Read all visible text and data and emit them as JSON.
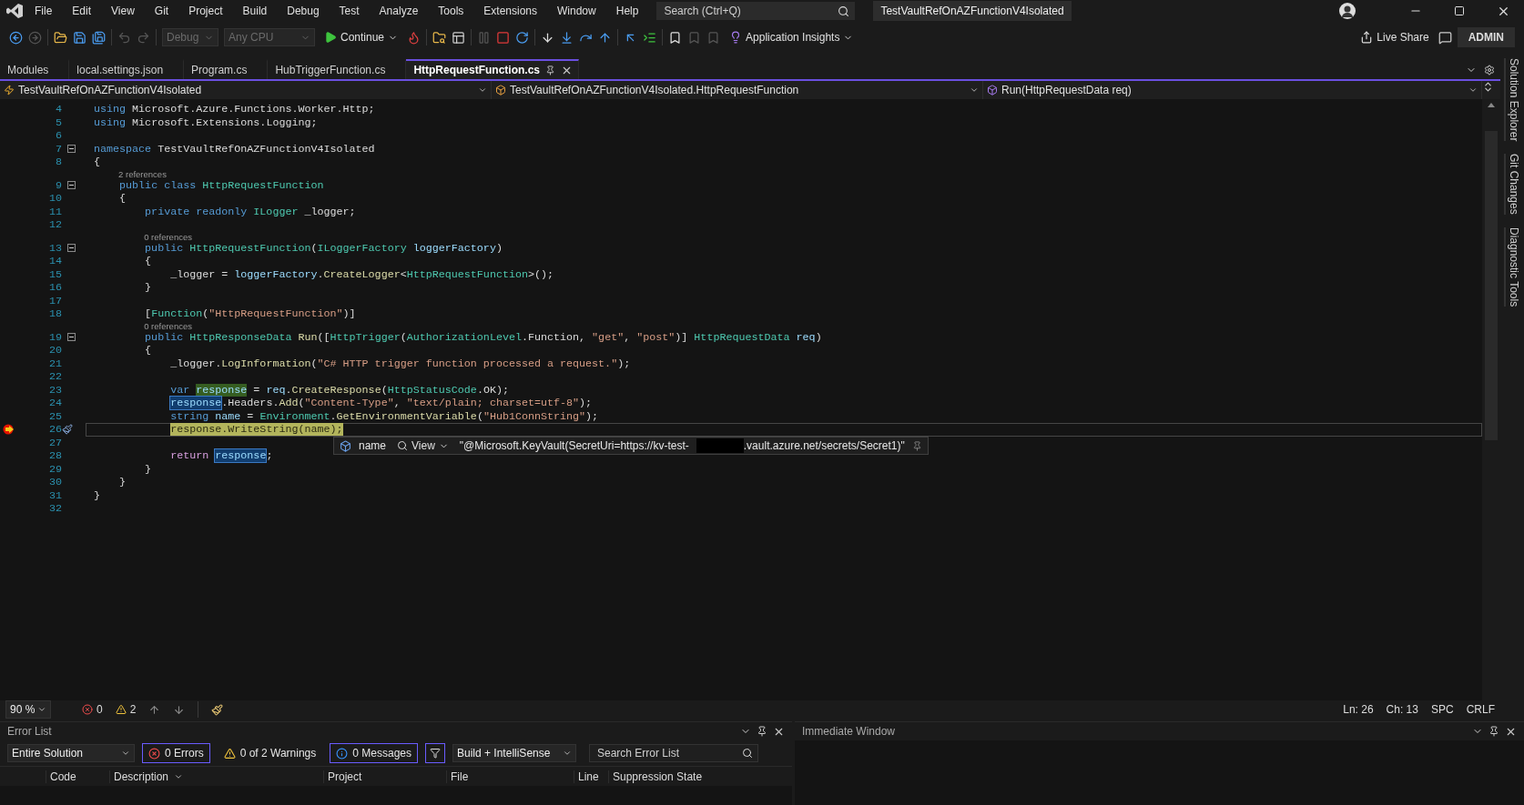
{
  "menu": {
    "items": [
      "File",
      "Edit",
      "View",
      "Git",
      "Project",
      "Build",
      "Debug",
      "Test",
      "Analyze",
      "Tools",
      "Extensions",
      "Window",
      "Help"
    ],
    "search_placeholder": "Search (Ctrl+Q)",
    "solution": "TestVaultRefOnAZFunctionV4Isolated"
  },
  "toolbar": {
    "configuration": "Debug",
    "platform": "Any CPU",
    "continue": "Continue",
    "insights": "Application Insights",
    "live_share": "Live Share",
    "account": "ADMIN"
  },
  "tabs": [
    {
      "label": "Modules",
      "selected": false
    },
    {
      "label": "local.settings.json",
      "selected": false
    },
    {
      "label": "Program.cs",
      "selected": false
    },
    {
      "label": "HubTriggerFunction.cs",
      "selected": false
    },
    {
      "label": "HttpRequestFunction.cs",
      "selected": true
    }
  ],
  "nav": {
    "project": "TestVaultRefOnAZFunctionV4Isolated",
    "type": "TestVaultRefOnAZFunctionV4Isolated.HttpRequestFunction",
    "member": "Run(HttpRequestData req)"
  },
  "code": {
    "lines": [
      {
        "number": "4",
        "foldable": false,
        "current": false,
        "tokens": [
          {
            "kind": "kw",
            "text": "using"
          },
          {
            "kind": "plain",
            "text": " Microsoft.Azure.Functions.Worker.Http;"
          }
        ]
      },
      {
        "number": "5",
        "foldable": false,
        "current": false,
        "tokens": [
          {
            "kind": "kw",
            "text": "using"
          },
          {
            "kind": "plain",
            "text": " Microsoft.Extensions.Logging;"
          }
        ]
      },
      {
        "number": "6",
        "foldable": false,
        "current": false
      },
      {
        "number": "7",
        "foldable": true,
        "current": false,
        "tokens": [
          {
            "kind": "kw",
            "text": "namespace"
          },
          {
            "kind": "plain",
            "text": " TestVaultRefOnAZFunctionV4Isolated"
          }
        ]
      },
      {
        "number": "8",
        "foldable": false,
        "current": false,
        "tokens": [
          {
            "kind": "plain",
            "text": "{"
          }
        ]
      },
      {
        "number": "9",
        "foldable": true,
        "current": false,
        "refs": "2 references",
        "tokens": [
          {
            "kind": "kw",
            "text": "    public class "
          },
          {
            "kind": "type",
            "text": "HttpRequestFunction"
          }
        ]
      },
      {
        "number": "10",
        "foldable": false,
        "current": false,
        "tokens": [
          {
            "kind": "plain",
            "text": "    {"
          }
        ]
      },
      {
        "number": "11",
        "foldable": false,
        "current": false,
        "tokens": [
          {
            "kind": "kw",
            "text": "        private readonly "
          },
          {
            "kind": "type",
            "text": "ILogger"
          },
          {
            "kind": "plain",
            "text": " _logger;"
          }
        ]
      },
      {
        "number": "12",
        "foldable": false,
        "current": false
      },
      {
        "number": "13",
        "foldable": true,
        "current": false,
        "refs": "0 references",
        "tokens": [
          {
            "kind": "kw",
            "text": "        public "
          },
          {
            "kind": "type",
            "text": "HttpRequestFunction"
          },
          {
            "kind": "plain",
            "text": "("
          },
          {
            "kind": "type",
            "text": "ILoggerFactory"
          },
          {
            "kind": "param",
            "text": " loggerFactory"
          },
          {
            "kind": "plain",
            "text": ")"
          }
        ]
      },
      {
        "number": "14",
        "foldable": false,
        "current": false,
        "tokens": [
          {
            "kind": "plain",
            "text": "        {"
          }
        ]
      },
      {
        "number": "15",
        "foldable": false,
        "current": false,
        "tokens": [
          {
            "kind": "plain",
            "text": "            _logger = "
          },
          {
            "kind": "param",
            "text": "loggerFactory"
          },
          {
            "kind": "plain",
            "text": "."
          },
          {
            "kind": "method",
            "text": "CreateLogger"
          },
          {
            "kind": "plain",
            "text": "<"
          },
          {
            "kind": "type",
            "text": "HttpRequestFunction"
          },
          {
            "kind": "plain",
            "text": ">();"
          }
        ]
      },
      {
        "number": "16",
        "foldable": false,
        "current": false,
        "tokens": [
          {
            "kind": "plain",
            "text": "        }"
          }
        ]
      },
      {
        "number": "17",
        "foldable": false,
        "current": false
      },
      {
        "number": "18",
        "foldable": false,
        "current": false,
        "tokens": [
          {
            "kind": "plain",
            "text": "        ["
          },
          {
            "kind": "type",
            "text": "Function"
          },
          {
            "kind": "plain",
            "text": "("
          },
          {
            "kind": "str",
            "text": "\"HttpRequestFunction\""
          },
          {
            "kind": "plain",
            "text": ")]"
          }
        ]
      },
      {
        "number": "19",
        "foldable": true,
        "current": false,
        "refs": "0 references",
        "tokens": [
          {
            "kind": "kw",
            "text": "        public "
          },
          {
            "kind": "type",
            "text": "HttpResponseData"
          },
          {
            "kind": "method",
            "text": " Run"
          },
          {
            "kind": "plain",
            "text": "(["
          },
          {
            "kind": "type",
            "text": "HttpTrigger"
          },
          {
            "kind": "plain",
            "text": "("
          },
          {
            "kind": "type",
            "text": "AuthorizationLevel"
          },
          {
            "kind": "plain",
            "text": ".Function, "
          },
          {
            "kind": "str",
            "text": "\"get\""
          },
          {
            "kind": "plain",
            "text": ", "
          },
          {
            "kind": "str",
            "text": "\"post\""
          },
          {
            "kind": "plain",
            "text": ")] "
          },
          {
            "kind": "type",
            "text": "HttpRequestData"
          },
          {
            "kind": "param",
            "text": " req"
          },
          {
            "kind": "plain",
            "text": ")"
          }
        ]
      },
      {
        "number": "20",
        "foldable": false,
        "current": false,
        "tokens": [
          {
            "kind": "plain",
            "text": "        {"
          }
        ]
      },
      {
        "number": "21",
        "foldable": false,
        "current": false,
        "tokens": [
          {
            "kind": "plain",
            "text": "            _logger."
          },
          {
            "kind": "method",
            "text": "LogInformation"
          },
          {
            "kind": "plain",
            "text": "("
          },
          {
            "kind": "str",
            "text": "\"C# HTTP trigger function processed a request.\""
          },
          {
            "kind": "plain",
            "text": ");"
          }
        ]
      },
      {
        "number": "22",
        "foldable": false,
        "current": false
      },
      {
        "number": "23",
        "foldable": false,
        "current": false,
        "tokens": [
          {
            "kind": "kw",
            "text": "            var "
          },
          {
            "kind": "write",
            "text": "response"
          },
          {
            "kind": "plain",
            "text": " = "
          },
          {
            "kind": "param",
            "text": "req"
          },
          {
            "kind": "plain",
            "text": "."
          },
          {
            "kind": "method",
            "text": "CreateResponse"
          },
          {
            "kind": "plain",
            "text": "("
          },
          {
            "kind": "type",
            "text": "HttpStatusCode"
          },
          {
            "kind": "plain",
            "text": ".OK);"
          }
        ]
      },
      {
        "number": "24",
        "foldable": false,
        "current": false,
        "tokens": [
          {
            "kind": "read",
            "text": "            response"
          },
          {
            "kind": "plain",
            "text": ".Headers."
          },
          {
            "kind": "method",
            "text": "Add"
          },
          {
            "kind": "plain",
            "text": "("
          },
          {
            "kind": "str",
            "text": "\"Content-Type\""
          },
          {
            "kind": "plain",
            "text": ", "
          },
          {
            "kind": "str",
            "text": "\"text/plain; charset=utf-8\""
          },
          {
            "kind": "plain",
            "text": ");"
          }
        ]
      },
      {
        "number": "25",
        "foldable": false,
        "current": false,
        "tokens": [
          {
            "kind": "kw",
            "text": "            string "
          },
          {
            "kind": "param",
            "text": "name"
          },
          {
            "kind": "plain",
            "text": " = "
          },
          {
            "kind": "type",
            "text": "Environment"
          },
          {
            "kind": "plain",
            "text": "."
          },
          {
            "kind": "method",
            "text": "GetEnvironmentVariable"
          },
          {
            "kind": "plain",
            "text": "("
          },
          {
            "kind": "str",
            "text": "\"Hub1ConnString\""
          },
          {
            "kind": "plain",
            "text": ");"
          }
        ]
      },
      {
        "number": "26",
        "foldable": false,
        "current": true,
        "tokens": [
          {
            "kind": "statement",
            "text": "            response.WriteString(name);"
          }
        ]
      },
      {
        "number": "27",
        "foldable": false,
        "current": false
      },
      {
        "number": "28",
        "foldable": false,
        "current": false,
        "tokens": [
          {
            "kind": "ctrl",
            "text": "            return "
          },
          {
            "kind": "read",
            "text": "response"
          },
          {
            "kind": "plain",
            "text": ";"
          }
        ]
      },
      {
        "number": "29",
        "foldable": false,
        "current": false,
        "tokens": [
          {
            "kind": "plain",
            "text": "        }"
          }
        ]
      },
      {
        "number": "30",
        "foldable": false,
        "current": false,
        "tokens": [
          {
            "kind": "plain",
            "text": "    }"
          }
        ]
      },
      {
        "number": "31",
        "foldable": false,
        "current": false,
        "tokens": [
          {
            "kind": "plain",
            "text": "}"
          }
        ]
      },
      {
        "number": "32",
        "foldable": false,
        "current": false
      }
    ],
    "datatip": {
      "name": "name",
      "view": "View",
      "value_start": "\"@Microsoft.KeyVault(SecretUri=https://kv-test-",
      "value_end": ".vault.azure.net/secrets/Secret1)\""
    }
  },
  "editor_status": {
    "zoom": "90 %",
    "errors": "0",
    "warnings": "2",
    "line": "Ln: 26",
    "column": "Ch: 13",
    "spacing": "SPC",
    "line_ending": "CRLF"
  },
  "side_tabs": [
    "Solution Explorer",
    "Git Changes",
    "Diagnostic Tools"
  ],
  "error_list": {
    "title": "Error List",
    "scope": "Entire Solution",
    "filters": [
      {
        "kind": "error",
        "label": "0 Errors",
        "selected": true
      },
      {
        "kind": "warning",
        "label": "0 of 2 Warnings",
        "selected": false
      },
      {
        "kind": "info",
        "label": "0 Messages",
        "selected": true
      }
    ],
    "source": "Build + IntelliSense",
    "search_placeholder": "Search Error List",
    "columns": [
      "Code",
      "Description",
      "Project",
      "File",
      "Line",
      "Suppression State"
    ]
  },
  "immediate": {
    "title": "Immediate Window"
  }
}
